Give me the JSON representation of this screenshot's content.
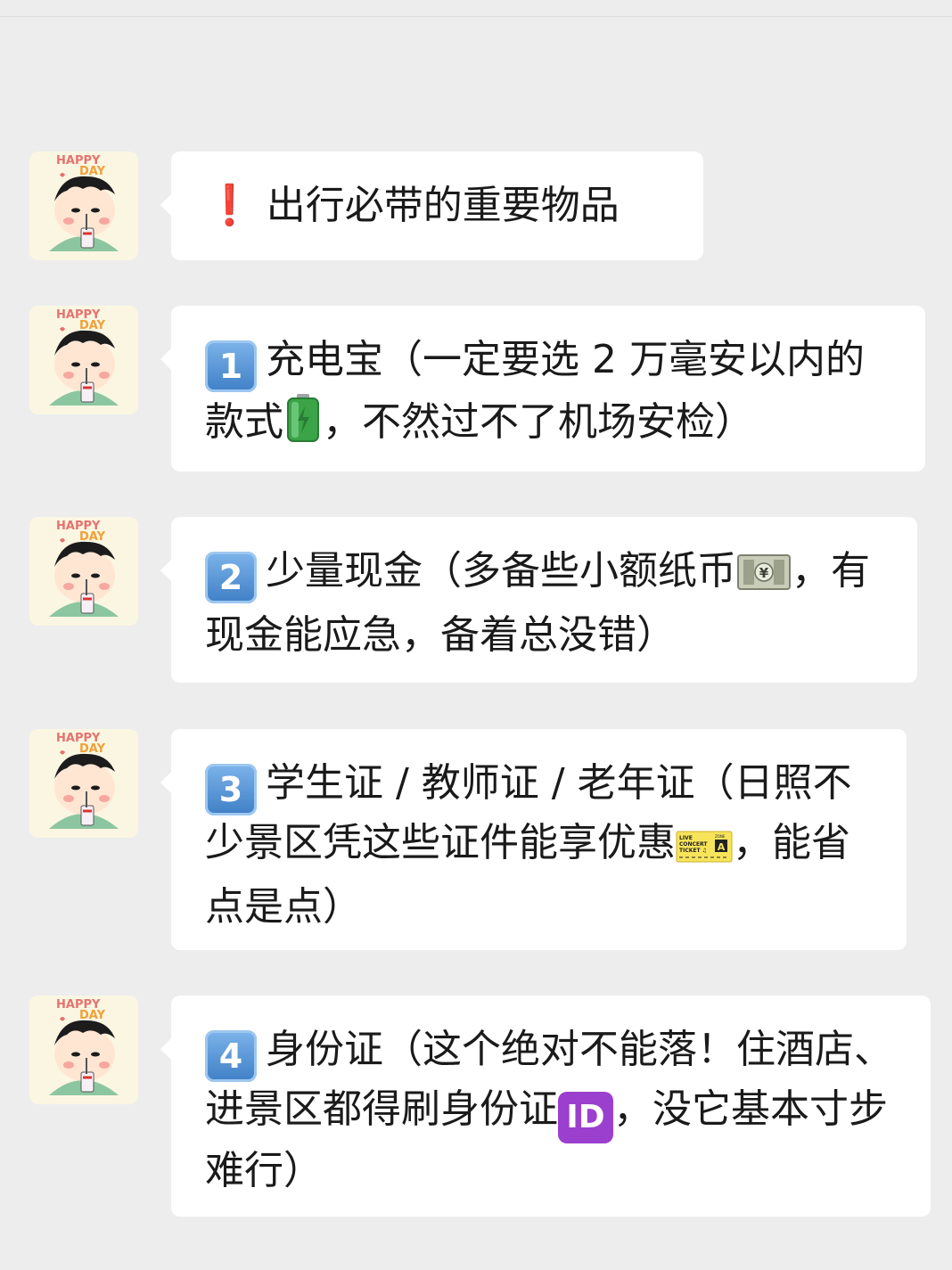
{
  "avatar": {
    "label_line1": "HAPPY",
    "label_line2": "DAY"
  },
  "messages": [
    {
      "prefix": "❗",
      "text": "出行必带的重要物品"
    },
    {
      "number": "1",
      "part1": "充电宝（一定要选 2 万毫安以内的款式",
      "emoji": "battery-icon",
      "part2": "，不然过不了机场安检）"
    },
    {
      "number": "2",
      "part1": "少量现金（多备些小额纸币",
      "emoji": "yen-banknote-icon",
      "part2": "，有现金能应急，备着总没错）"
    },
    {
      "number": "3",
      "part1": "学生证 / 教师证 / 老年证（日照不少景区凭这些证件能享优惠",
      "emoji": "concert-ticket-icon",
      "ticket_text": [
        "LIVE",
        "CONCERT",
        "TICKET ♫",
        "ZONE",
        "A"
      ],
      "part2": "，能省点是点）"
    },
    {
      "number": "4",
      "part1": "身份证（这个绝对不能落！住酒店、进景区都得刷身份证",
      "emoji": "id-icon",
      "emoji_text": "ID",
      "part2": "，没它基本寸步难行）"
    }
  ],
  "colors": {
    "background": "#ededed",
    "bubble": "#ffffff",
    "text": "#1a1a1a",
    "keycap": "#4a8bd0",
    "exclamation": "#e02020",
    "id_emoji": "#9b3fcf"
  }
}
